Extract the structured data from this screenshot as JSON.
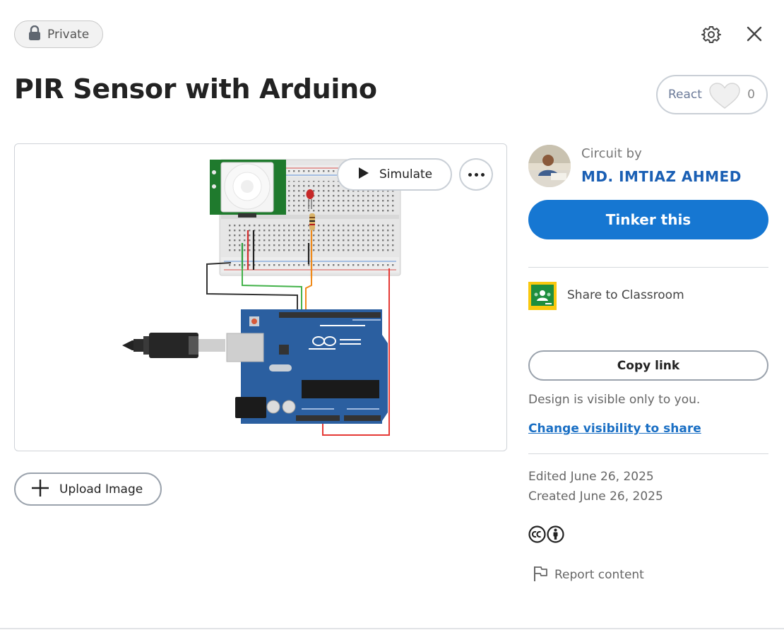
{
  "header": {
    "privacy_label": "Private",
    "lock_icon": "lock-icon",
    "settings_icon": "gear-icon",
    "close_icon": "close-icon"
  },
  "page": {
    "title": "PIR Sensor with Arduino"
  },
  "react": {
    "label": "React",
    "count": "0",
    "icon": "heart-icon"
  },
  "preview": {
    "simulate_label": "Simulate",
    "more_icon": "more-icon",
    "image_description": "circuit-schematic"
  },
  "upload": {
    "label": "Upload Image",
    "icon": "plus-icon"
  },
  "author": {
    "caption": "Circuit by",
    "name": "MD. IMTIAZ AHMED"
  },
  "actions": {
    "tinker_label": "Tinker this",
    "classroom_label": "Share to Classroom",
    "copy_link_label": "Copy link",
    "visibility_note": "Design is visible only to you.",
    "change_visibility_label": "Change visibility to share"
  },
  "meta": {
    "edited": "Edited June 26, 2025",
    "created": "Created June 26, 2025",
    "report_label": "Report content"
  },
  "colors": {
    "accent": "#1677d2",
    "author_link": "#1a5fb4",
    "classroom_green": "#1e8e3e",
    "classroom_yellow": "#f9c80e",
    "arduino_blue": "#2b5fa0",
    "pir_board_green": "#1f7a2d"
  }
}
